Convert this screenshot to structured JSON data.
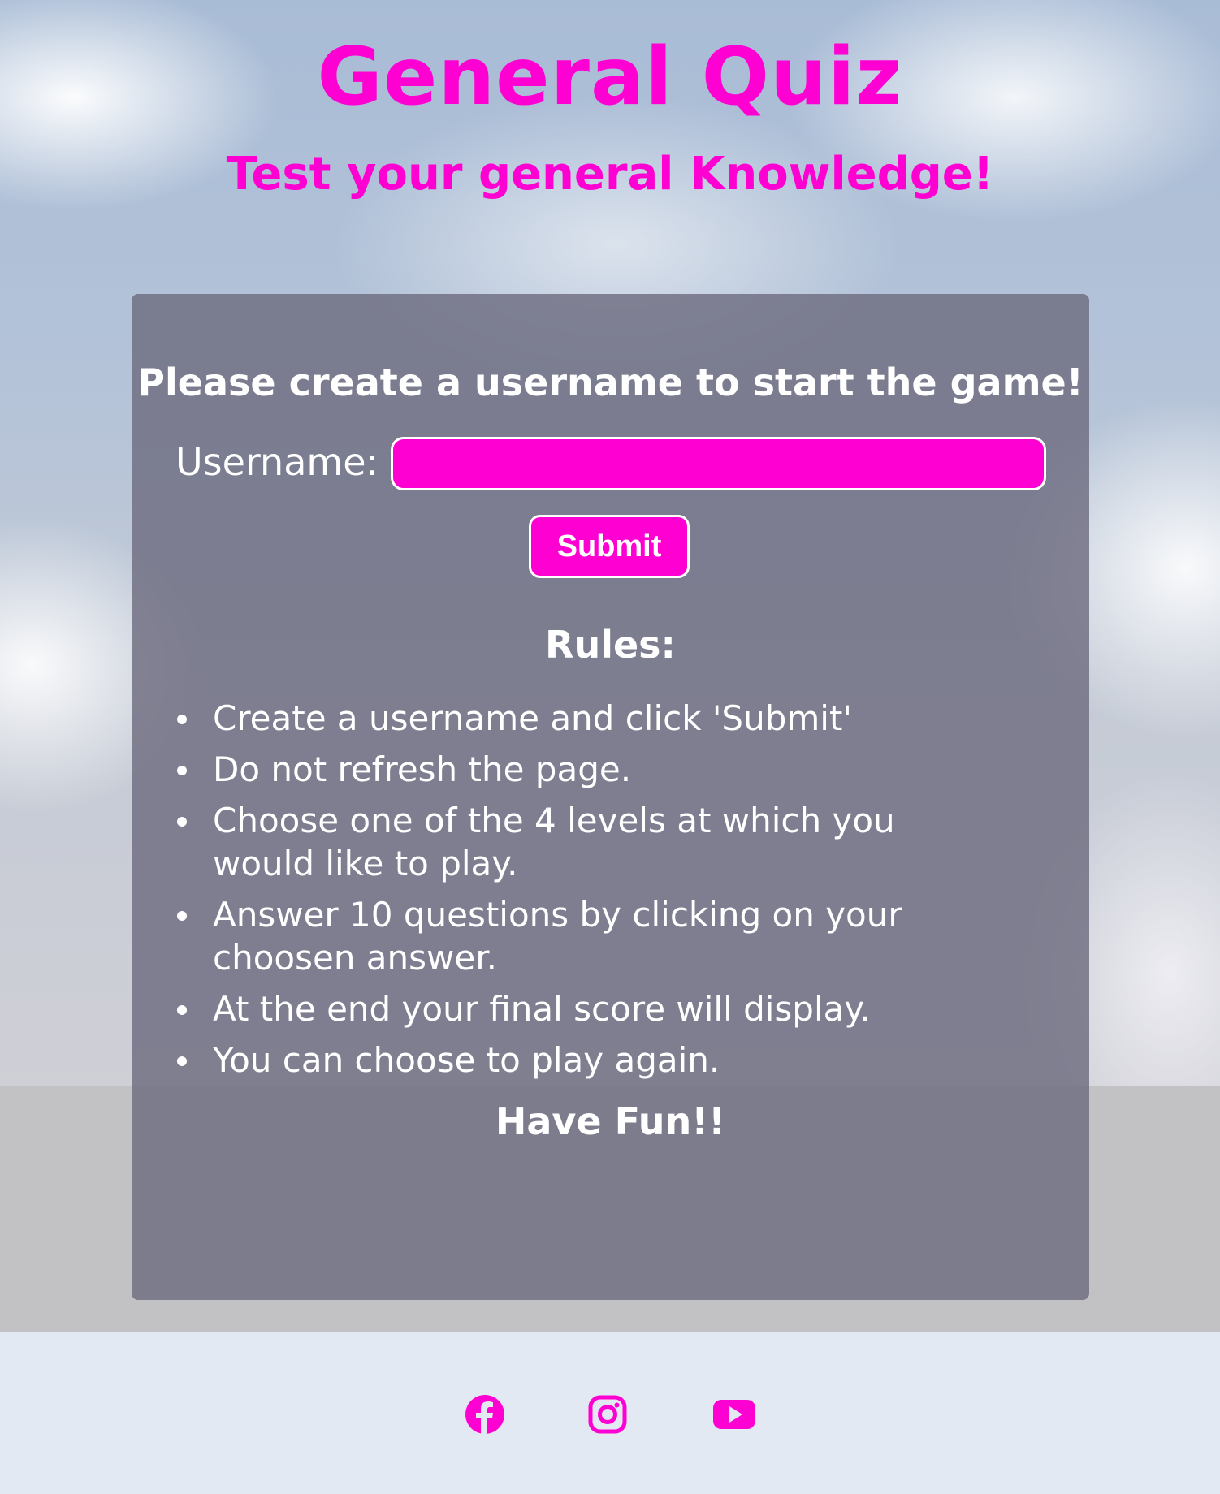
{
  "header": {
    "title": "General Quiz",
    "subtitle": "Test your general Knowledge!"
  },
  "card": {
    "heading": "Please create a username to start the game!",
    "username_label": "Username:",
    "username_value": "",
    "submit_label": "Submit",
    "rules_heading": "Rules:",
    "rules": [
      "Create a username and click 'Submit'",
      "Do not refresh the page.",
      "Choose one of the 4 levels at which you would like to play.",
      "Answer 10 questions by clicking on your choosen answer.",
      "At the end your final score will display.",
      "You can choose to play again."
    ],
    "closing": "Have Fun!!"
  },
  "footer": {
    "icons": [
      "facebook-icon",
      "instagram-icon",
      "youtube-icon"
    ]
  },
  "colors": {
    "accent": "#ff00d2",
    "card_bg": "#6e6c80",
    "footer_bg": "#e3e9f2",
    "text_light": "#ffffff"
  }
}
